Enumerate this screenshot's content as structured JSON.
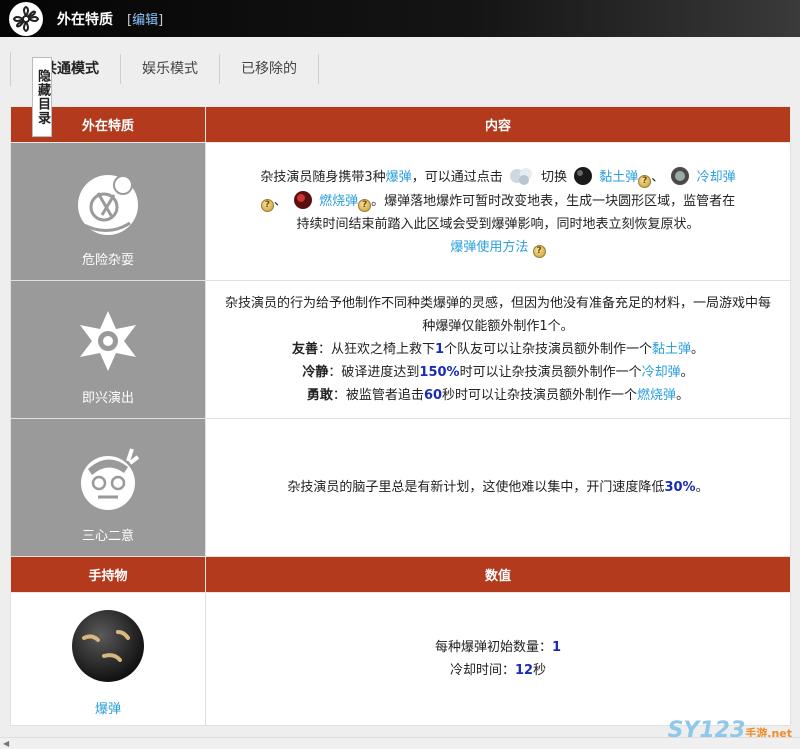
{
  "header": {
    "title": "外在特质",
    "edit_open": "[",
    "edit_label": "编辑",
    "edit_close": "]"
  },
  "tabs": [
    {
      "label": "共通模式"
    },
    {
      "label": "娱乐模式"
    },
    {
      "label": "已移除的"
    }
  ],
  "toc": {
    "label": "隐藏目录"
  },
  "table1": {
    "col1": "外在特质",
    "col2": "内容",
    "rows": [
      {
        "name": "危险杂耍",
        "line1_a": "杂技演员随身携带3种",
        "line1_link": "爆弹",
        "line1_b": "，可以通过点击",
        "line1_c": "切换",
        "clay": "黏土弹",
        "sep1": "、",
        "cold": "冷却弹",
        "sep2": "、",
        "fire": "燃烧弹",
        "line2_b": "。爆弹落地爆炸可暂时改变地表，生成一块圆形区域，监管者在",
        "line3": "持续时间结束前踏入此区域会受到爆弹影响，同时地表立刻恢复原状。",
        "usage": "爆弹使用方法"
      },
      {
        "name": "即兴演出",
        "intro": "杂技演员的行为给予他制作不同种类爆弹的灵感，但因为他没有准备充足的材料，一局游戏中每种爆弹仅能额外制作1个。",
        "friendly_label": "友善",
        "friendly_a": "：从狂欢之椅上救下",
        "friendly_num": "1",
        "friendly_b": "个队友可以让杂技演员额外制作一个",
        "friendly_link": "黏土弹",
        "friendly_end": "。",
        "calm_label": "冷静",
        "calm_a": "：破译进度达到",
        "calm_num": "150%",
        "calm_b": "时可以让杂技演员额外制作一个",
        "calm_link": "冷却弹",
        "calm_end": "。",
        "brave_label": "勇敢",
        "brave_a": "：被监管者追击",
        "brave_num": "60",
        "brave_b": "秒时可以让杂技演员额外制作一个",
        "brave_link": "燃烧弹",
        "brave_end": "。"
      },
      {
        "name": "三心二意",
        "text_a": "杂技演员的脑子里总是有新计划，这使他难以集中，开门速度降低",
        "num": "30%",
        "text_b": "。"
      }
    ]
  },
  "table2": {
    "col1": "手持物",
    "col2": "数值",
    "item_name": "爆弹",
    "count_label": "每种爆弹初始数量：",
    "count_value": "1",
    "cd_label": "冷却时间：",
    "cd_value": "12",
    "cd_unit": "秒"
  },
  "watermark": {
    "text": "SY123",
    "sub": "手游",
    "domain": ".net"
  },
  "colors": {
    "header_red": "#b33a1c",
    "link": "#2b9fdc",
    "num": "#1a2bb8",
    "icon_bg": "#9a9a9a"
  }
}
